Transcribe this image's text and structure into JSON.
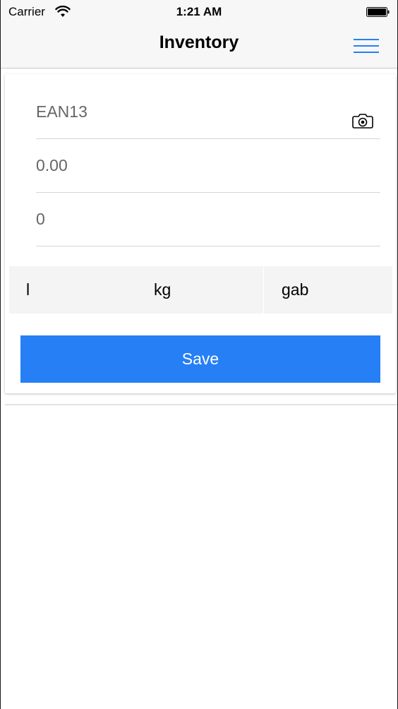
{
  "status_bar": {
    "carrier": "Carrier",
    "time": "1:21 AM",
    "icons": [
      "wifi-icon",
      "battery-icon"
    ]
  },
  "nav": {
    "title": "Inventory",
    "menu_icon": "hamburger-menu-icon",
    "accent_color": "#277ff6"
  },
  "form": {
    "ean_field": {
      "placeholder": "EAN13",
      "value": "",
      "icon": "camera-icon"
    },
    "price_field": {
      "placeholder": "0.00",
      "value": ""
    },
    "quantity_field": {
      "placeholder": "0",
      "value": ""
    },
    "units": [
      "l",
      "kg",
      "gab"
    ],
    "save_label": "Save",
    "save_color": "#277ff6"
  }
}
